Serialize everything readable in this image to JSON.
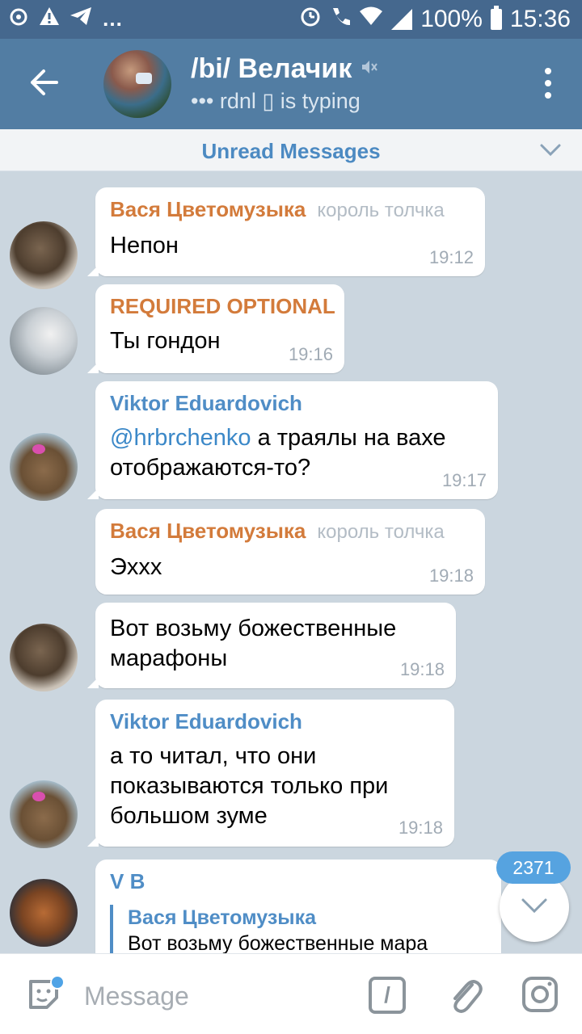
{
  "status_bar": {
    "battery": "100%",
    "time": "15:36",
    "icons": [
      "vpn-icon",
      "warning-icon",
      "telegram-icon",
      "more-dots",
      "alarm-icon",
      "wifi-call-icon",
      "wifi-icon",
      "signal-icon",
      "battery-icon"
    ]
  },
  "header": {
    "title": "/bi/ Велачик",
    "subtitle": "••• rdnl ▯ is typing",
    "icons": [
      "back-arrow-icon",
      "mute-icon",
      "more-vert-icon"
    ]
  },
  "unread_bar": {
    "label": "Unread Messages"
  },
  "messages": [
    {
      "sender": "Вася Цветомузыка",
      "badge": "король толчка",
      "text": "Непон",
      "time": "19:12",
      "avatar": "otter"
    },
    {
      "sender": "REQUIRED OPTIONAL",
      "text": "Ты гондон",
      "time": "19:16",
      "avatar": "ghost"
    },
    {
      "sender": "Viktor Eduardovich",
      "mention": "@hrbrchenko",
      "text": " а траялы на вахе отображаются-то?",
      "time": "19:17",
      "avatar": "capybara"
    },
    {
      "sender": "Вася Цветомузыка",
      "badge": "король толчка",
      "text": "Эххх",
      "time": "19:18",
      "avatar": "otter"
    },
    {
      "text": "Вот возьму божественные марафоны",
      "time": "19:18",
      "avatar": "otter"
    },
    {
      "sender": "Viktor Eduardovich",
      "text": "а то читал, что они показываются только при большом зуме",
      "time": "19:18",
      "avatar": "capybara"
    },
    {
      "sender": "V B",
      "reply_name": "Вася Цветомузыка",
      "reply_text": "Вот возьму божественные мара",
      "avatar": "fox"
    }
  ],
  "scroll_button": {
    "badge": "2371"
  },
  "input_bar": {
    "placeholder": "Message",
    "command_label": "/"
  }
}
